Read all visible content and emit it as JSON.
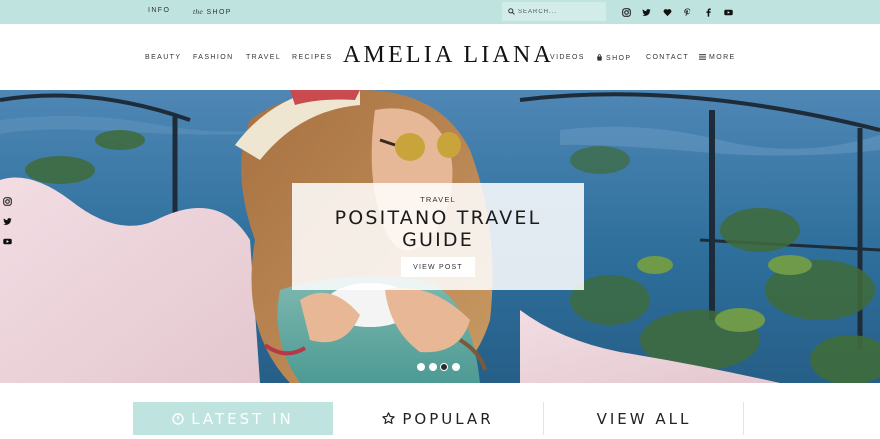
{
  "topbar": {
    "info_label": "INFO",
    "shop_the": "the",
    "shop_label": "SHOP",
    "search_placeholder": "SEARCH...",
    "socials": [
      "instagram-icon",
      "twitter-icon",
      "heart-icon",
      "pinterest-icon",
      "facebook-icon",
      "youtube-icon"
    ]
  },
  "header": {
    "logo": "AMELIA LIANA",
    "nav_left": [
      "BEAUTY",
      "FASHION",
      "TRAVEL",
      "RECIPES"
    ],
    "nav_right": {
      "videos": "VIDEOS",
      "shop": "SHOP",
      "contact": "CONTACT",
      "more": "MORE"
    }
  },
  "hero": {
    "category": "TRAVEL",
    "title_line1": "POSITANO TRAVEL",
    "title_line2": "GUIDE",
    "button": "VIEW POST",
    "slides_count": 4,
    "active_slide": 3,
    "side_socials": [
      "instagram-icon",
      "twitter-icon",
      "youtube-icon"
    ]
  },
  "tabs": {
    "latest": "LATEST IN",
    "popular": "POPULAR",
    "view_all": "VIEW ALL"
  },
  "colors": {
    "accent": "#bfe3df",
    "search_bg": "#d2ece9",
    "text_dark": "#222222"
  }
}
